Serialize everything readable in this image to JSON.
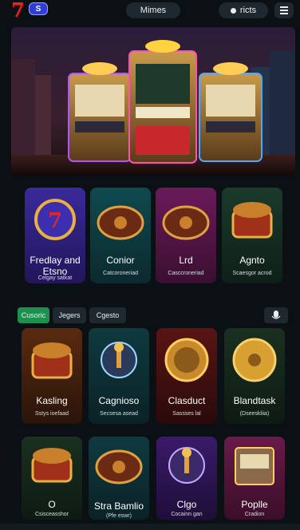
{
  "header": {
    "logo_text": "7",
    "logo_badge": "S",
    "menus_label": "Mimes",
    "right_pill_label": "ricts"
  },
  "featured": [
    {
      "title": "Fredlay and Etsno",
      "subtitle": "Celgay satkat",
      "art": "seven-coin",
      "theme": "purple"
    },
    {
      "title": "Conior",
      "subtitle": "Catcoroneriad",
      "art": "roulette",
      "theme": "teal"
    },
    {
      "title": "Lrd",
      "subtitle": "Casccroneriad",
      "art": "roulette",
      "theme": "magenta"
    },
    {
      "title": "Agnto",
      "subtitle": "Scaesgor acrod",
      "art": "treasure",
      "theme": "green"
    }
  ],
  "filters": {
    "chips": [
      "Cusoric",
      "Jegers",
      "Cgesto"
    ],
    "active_index": 0
  },
  "games_row1": [
    {
      "title": "Kasling",
      "subtitle": "Sstys ioefaad",
      "art": "treasure",
      "theme": "orange"
    },
    {
      "title": "Cagnioso",
      "subtitle": "Secsesa asead",
      "art": "joystick",
      "theme": "teal"
    },
    {
      "title": "Clasduct",
      "subtitle": "Sassses lal",
      "art": "coin-gold",
      "theme": "red"
    },
    {
      "title": "Blandtask",
      "subtitle": "(Dseeskliia)",
      "art": "wheel",
      "theme": "green"
    }
  ],
  "games_row2": [
    {
      "title": "O",
      "subtitle": "Csisceasshor",
      "art": "treasure",
      "theme": "green"
    },
    {
      "title": "Stra Bamlio",
      "subtitle": "(Pfe eswr)",
      "art": "roulette",
      "theme": "teal"
    },
    {
      "title": "Clgo",
      "subtitle": "Cocainn gan",
      "art": "joystick",
      "theme": "purple"
    },
    {
      "title": "Poplle",
      "subtitle": "Cradion",
      "art": "slot",
      "theme": "pink"
    }
  ]
}
